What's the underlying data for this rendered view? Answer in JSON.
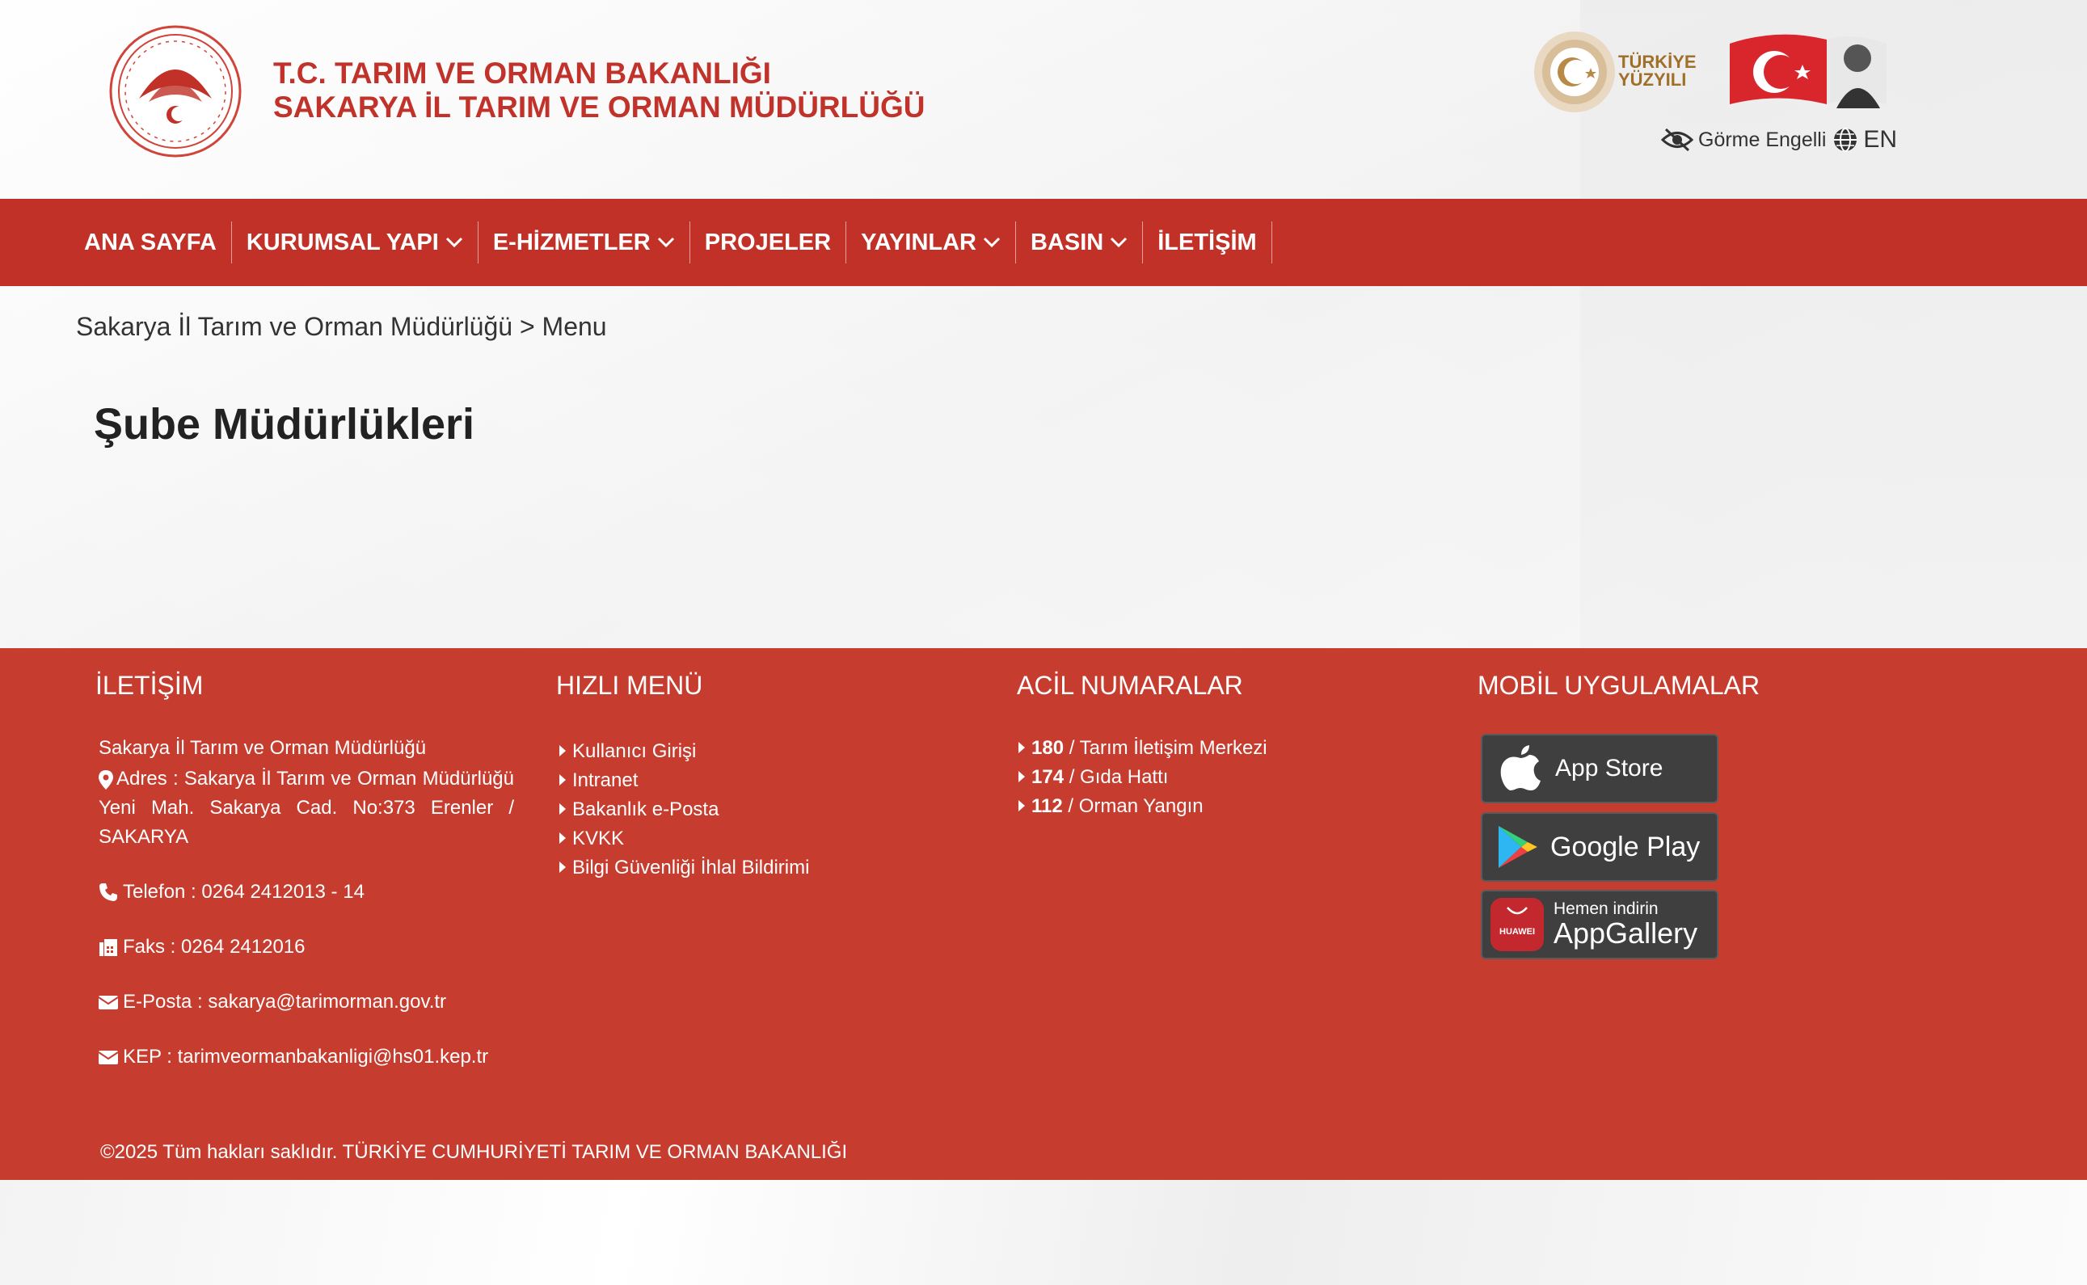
{
  "header": {
    "title_line1": "T.C. TARIM VE ORMAN BAKANLIĞI",
    "title_line2": "SAKARYA İL TARIM VE ORMAN MÜDÜRLÜĞÜ",
    "turkiye_yuzyili_line1": "TÜRKİYE",
    "turkiye_yuzyili_line2": "YÜZYILI",
    "accessibility_label": "Görme Engelli",
    "language_label": "EN"
  },
  "nav": {
    "items": [
      {
        "label": "ANA SAYFA",
        "dropdown": false
      },
      {
        "label": "KURUMSAL YAPI",
        "dropdown": true
      },
      {
        "label": "E-HİZMETLER",
        "dropdown": true
      },
      {
        "label": "PROJELER",
        "dropdown": false
      },
      {
        "label": "YAYINLAR",
        "dropdown": true
      },
      {
        "label": "BASIN",
        "dropdown": true
      },
      {
        "label": "İLETİŞİM",
        "dropdown": false
      }
    ]
  },
  "breadcrumb": {
    "text": "Sakarya İl Tarım ve Orman Müdürlüğü > Menu"
  },
  "main": {
    "title": "Şube Müdürlükleri"
  },
  "footer": {
    "contact": {
      "heading": "İLETİŞİM",
      "org": "Sakarya İl Tarım ve Orman Müdürlüğü",
      "address": "Adres : Sakarya İl Tarım ve Orman Müdürlüğü Yeni Mah. Sakarya Cad. No:373 Erenler / SAKARYA",
      "phone": "Telefon : 0264 2412013 - 14",
      "fax": "Faks : 0264 2412016",
      "email": "E-Posta : sakarya@tarimorman.gov.tr",
      "kep": "KEP : tarimveormanbakanligi@hs01.kep.tr"
    },
    "quick_menu": {
      "heading": "HIZLI MENÜ",
      "items": [
        "Kullanıcı Girişi",
        "Intranet",
        "Bakanlık e-Posta",
        "KVKK",
        "Bilgi Güvenliği İhlal Bildirimi"
      ]
    },
    "emergency": {
      "heading": "ACİL NUMARALAR",
      "items": [
        {
          "number": "180",
          "label": " / Tarım İletişim Merkezi"
        },
        {
          "number": "174",
          "label": " / Gıda Hattı"
        },
        {
          "number": "112",
          "label": " / Orman Yangın"
        }
      ]
    },
    "apps": {
      "heading": "MOBİL UYGULAMALAR",
      "app_store": "App Store",
      "google_play": "Google Play",
      "huawei_brand": "HUAWEI",
      "huawei_sub": "Hemen indirin",
      "huawei_main": "AppGallery"
    },
    "copyright": "©2025 Tüm hakları saklıdır. TÜRKİYE CUMHURİYETİ TARIM VE ORMAN BAKANLIĞI"
  },
  "colors": {
    "brand_red": "#c13127",
    "footer_red": "#c63d2f",
    "title_red": "#c0322a"
  }
}
